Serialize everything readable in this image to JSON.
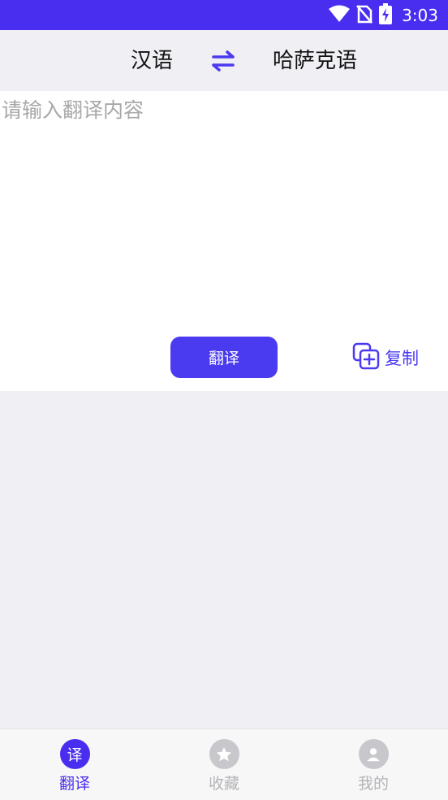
{
  "status_bar": {
    "time": "3:03"
  },
  "lang_bar": {
    "source": "汉语",
    "target": "哈萨克语"
  },
  "input": {
    "value": "",
    "placeholder": "请输入翻译内容"
  },
  "actions": {
    "translate_label": "翻译",
    "copy_label": "复制"
  },
  "bottom_nav": {
    "items": [
      {
        "label": "翻译",
        "icon_char": "译",
        "active": true
      },
      {
        "label": "收藏",
        "active": false
      },
      {
        "label": "我的",
        "active": false
      }
    ]
  },
  "colors": {
    "accent": "#4a2ef0",
    "button": "#4a3af0",
    "inactive": "#c8c8cc"
  }
}
